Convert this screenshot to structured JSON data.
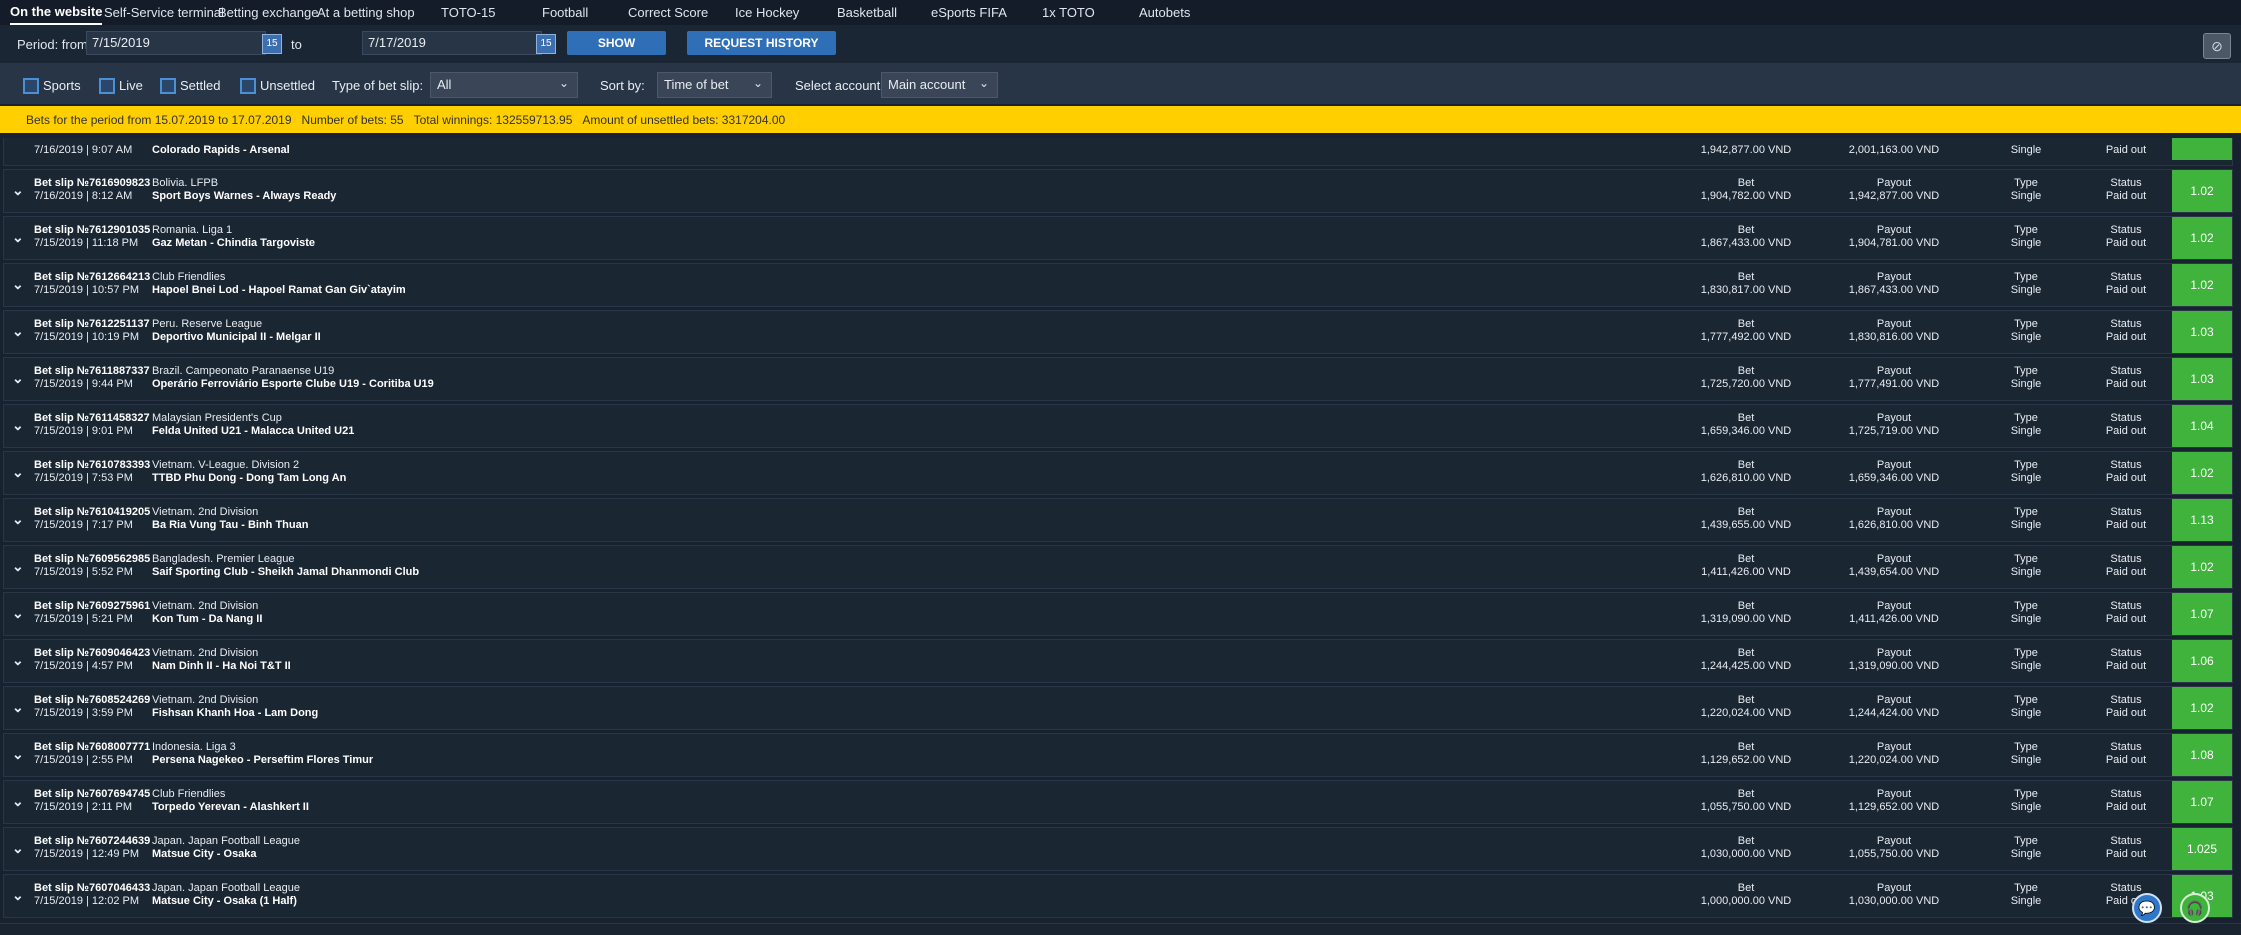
{
  "tabs": [
    "On the website",
    "Self-Service terminal",
    "Betting exchange",
    "At a betting shop",
    "TOTO-15",
    "Football",
    "Correct Score",
    "Ice Hockey",
    "Basketball",
    "eSports FIFA",
    "1x TOTO",
    "Autobets"
  ],
  "period": {
    "label": "Period: from",
    "from": "7/15/2019",
    "to_label": "to",
    "to": "7/17/2019",
    "cal_icon": "15",
    "show_btn": "SHOW",
    "history_btn": "REQUEST HISTORY"
  },
  "filters": {
    "sports": "Sports",
    "live": "Live",
    "settled": "Settled",
    "unsettled": "Unsettled",
    "type_label": "Type of bet slip:",
    "type_value": "All",
    "sort_label": "Sort by:",
    "sort_value": "Time of bet",
    "account_label": "Select account:",
    "account_value": "Main account"
  },
  "summary": {
    "period": "Bets for the period from 15.07.2019 to 17.07.2019",
    "count": "Number of bets: 55",
    "winnings": "Total winnings: 132559713.95",
    "unsettled": "Amount of unsettled bets: 3317204.00"
  },
  "first_row": {
    "dt": "7/16/2019 | 9:07 AM",
    "match": "Colorado Rapids - Arsenal",
    "bet": "1,942,877.00 VND",
    "payout": "2,001,163.00 VND",
    "type": "Single",
    "status": "Paid out"
  },
  "labels": {
    "bet": "Bet",
    "payout": "Payout",
    "type": "Type",
    "status": "Status"
  },
  "bets": [
    {
      "slip": "Bet slip №7616909823",
      "dt": "7/16/2019 | 8:12 AM",
      "league": "Bolivia. LFPB",
      "match": "Sport Boys Warnes - Always Ready",
      "bet": "1,904,782.00 VND",
      "payout": "1,942,877.00 VND",
      "type": "Single",
      "status": "Paid out",
      "odds": "1.02"
    },
    {
      "slip": "Bet slip №7612901035",
      "dt": "7/15/2019 | 11:18 PM",
      "league": "Romania. Liga 1",
      "match": "Gaz Metan - Chindia Targoviste",
      "bet": "1,867,433.00 VND",
      "payout": "1,904,781.00 VND",
      "type": "Single",
      "status": "Paid out",
      "odds": "1.02"
    },
    {
      "slip": "Bet slip №7612664213",
      "dt": "7/15/2019 | 10:57 PM",
      "league": "Club Friendlies",
      "match": "Hapoel Bnei Lod - Hapoel Ramat Gan Giv`atayim",
      "bet": "1,830,817.00 VND",
      "payout": "1,867,433.00 VND",
      "type": "Single",
      "status": "Paid out",
      "odds": "1.02"
    },
    {
      "slip": "Bet slip №7612251137",
      "dt": "7/15/2019 | 10:19 PM",
      "league": "Peru. Reserve League",
      "match": "Deportivo Municipal II - Melgar II",
      "bet": "1,777,492.00 VND",
      "payout": "1,830,816.00 VND",
      "type": "Single",
      "status": "Paid out",
      "odds": "1.03"
    },
    {
      "slip": "Bet slip №7611887337",
      "dt": "7/15/2019 | 9:44 PM",
      "league": "Brazil. Campeonato Paranaense U19",
      "match": "Operário Ferroviário Esporte Clube U19 - Coritiba U19",
      "bet": "1,725,720.00 VND",
      "payout": "1,777,491.00 VND",
      "type": "Single",
      "status": "Paid out",
      "odds": "1.03"
    },
    {
      "slip": "Bet slip №7611458327",
      "dt": "7/15/2019 | 9:01 PM",
      "league": "Malaysian President's Cup",
      "match": "Felda United U21 - Malacca United U21",
      "bet": "1,659,346.00 VND",
      "payout": "1,725,719.00 VND",
      "type": "Single",
      "status": "Paid out",
      "odds": "1.04"
    },
    {
      "slip": "Bet slip №7610783393",
      "dt": "7/15/2019 | 7:53 PM",
      "league": "Vietnam. V-League. Division 2",
      "match": "TTBD Phu Dong - Dong Tam Long An",
      "bet": "1,626,810.00 VND",
      "payout": "1,659,346.00 VND",
      "type": "Single",
      "status": "Paid out",
      "odds": "1.02"
    },
    {
      "slip": "Bet slip №7610419205",
      "dt": "7/15/2019 | 7:17 PM",
      "league": "Vietnam. 2nd Division",
      "match": "Ba Ria Vung Tau - Binh Thuan",
      "bet": "1,439,655.00 VND",
      "payout": "1,626,810.00 VND",
      "type": "Single",
      "status": "Paid out",
      "odds": "1.13"
    },
    {
      "slip": "Bet slip №7609562985",
      "dt": "7/15/2019 | 5:52 PM",
      "league": "Bangladesh. Premier League",
      "match": "Saif Sporting Club - Sheikh Jamal Dhanmondi Club",
      "bet": "1,411,426.00 VND",
      "payout": "1,439,654.00 VND",
      "type": "Single",
      "status": "Paid out",
      "odds": "1.02"
    },
    {
      "slip": "Bet slip №7609275961",
      "dt": "7/15/2019 | 5:21 PM",
      "league": "Vietnam. 2nd Division",
      "match": "Kon Tum - Da Nang II",
      "bet": "1,319,090.00 VND",
      "payout": "1,411,426.00 VND",
      "type": "Single",
      "status": "Paid out",
      "odds": "1.07"
    },
    {
      "slip": "Bet slip №7609046423",
      "dt": "7/15/2019 | 4:57 PM",
      "league": "Vietnam. 2nd Division",
      "match": "Nam Dinh II - Ha Noi T&T II",
      "bet": "1,244,425.00 VND",
      "payout": "1,319,090.00 VND",
      "type": "Single",
      "status": "Paid out",
      "odds": "1.06"
    },
    {
      "slip": "Bet slip №7608524269",
      "dt": "7/15/2019 | 3:59 PM",
      "league": "Vietnam. 2nd Division",
      "match": "Fishsan Khanh Hoa - Lam Dong",
      "bet": "1,220,024.00 VND",
      "payout": "1,244,424.00 VND",
      "type": "Single",
      "status": "Paid out",
      "odds": "1.02"
    },
    {
      "slip": "Bet slip №7608007771",
      "dt": "7/15/2019 | 2:55 PM",
      "league": "Indonesia. Liga 3",
      "match": "Persena Nagekeo - Perseftim Flores Timur",
      "bet": "1,129,652.00 VND",
      "payout": "1,220,024.00 VND",
      "type": "Single",
      "status": "Paid out",
      "odds": "1.08"
    },
    {
      "slip": "Bet slip №7607694745",
      "dt": "7/15/2019 | 2:11 PM",
      "league": "Club Friendlies",
      "match": "Torpedo Yerevan - Alashkert II",
      "bet": "1,055,750.00 VND",
      "payout": "1,129,652.00 VND",
      "type": "Single",
      "status": "Paid out",
      "odds": "1.07"
    },
    {
      "slip": "Bet slip №7607244639",
      "dt": "7/15/2019 | 12:49 PM",
      "league": "Japan. Japan Football League",
      "match": "Matsue City - Osaka",
      "bet": "1,030,000.00 VND",
      "payout": "1,055,750.00 VND",
      "type": "Single",
      "status": "Paid out",
      "odds": "1.025"
    },
    {
      "slip": "Bet slip №7607046433",
      "dt": "7/15/2019 | 12:02 PM",
      "league": "Japan. Japan Football League",
      "match": "Matsue City - Osaka (1  Half)",
      "bet": "1,000,000.00 VND",
      "payout": "1,030,000.00 VND",
      "type": "Single",
      "status": "Paid out",
      "odds": "1.03"
    }
  ],
  "colors": {
    "accent": "#2f6fb7",
    "summary_bg": "#ffcf00",
    "odds_bg": "#3fb33c",
    "bg": "#17212f"
  },
  "icons": {
    "chevron": "chevron-down-icon",
    "calendar": "calendar-icon",
    "eye": "eye-off-icon",
    "chat": "chat-icon",
    "support": "headset-icon"
  }
}
